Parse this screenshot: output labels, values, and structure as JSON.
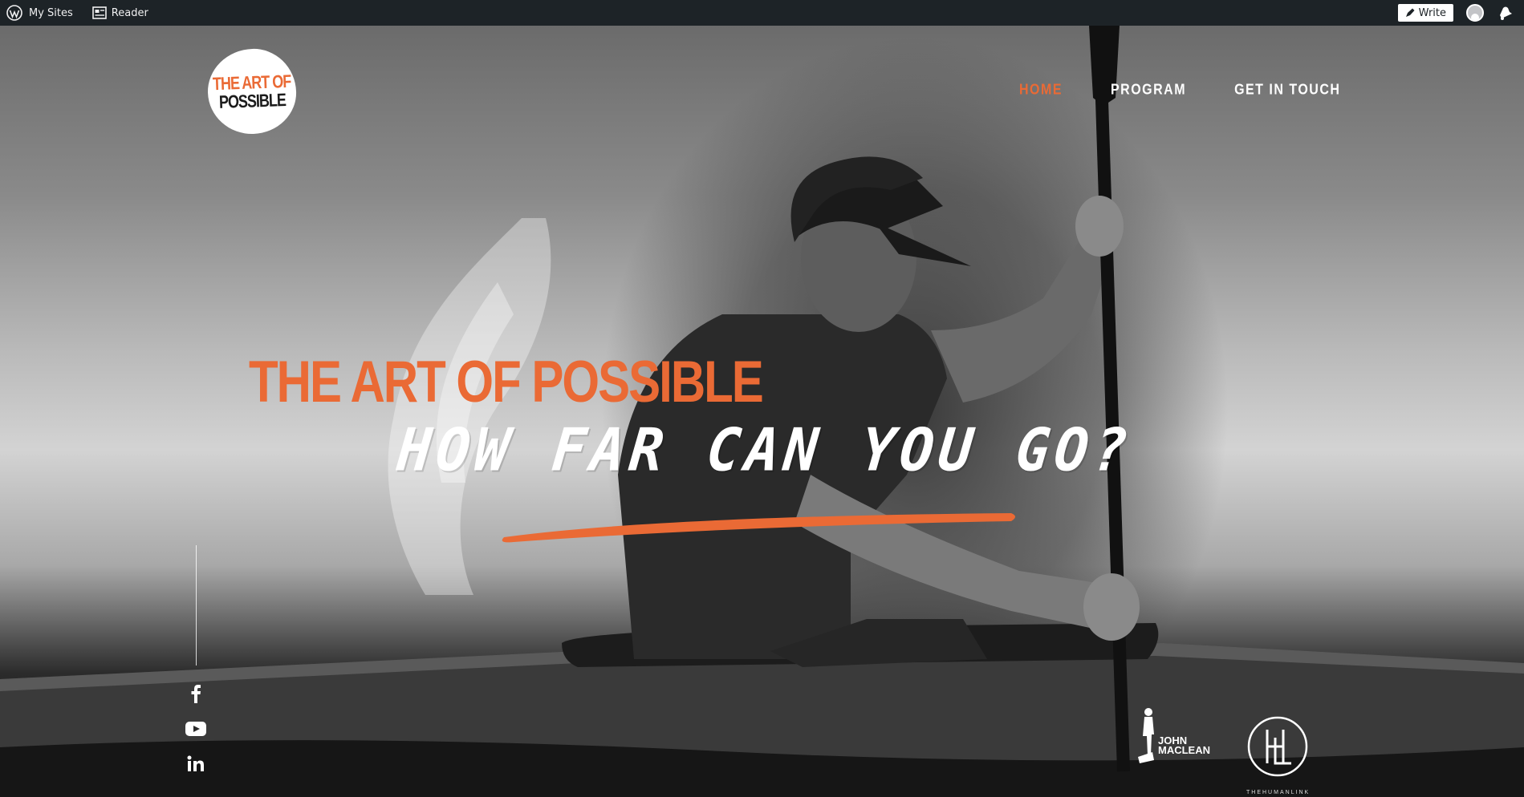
{
  "adminbar": {
    "my_sites": "My Sites",
    "reader": "Reader",
    "write": "Write"
  },
  "logo": {
    "line1": "THE ART OF",
    "line2": "POSSIBLE"
  },
  "nav": {
    "items": [
      {
        "label": "HOME",
        "active": true
      },
      {
        "label": "PROGRAM",
        "active": false
      },
      {
        "label": "GET IN TOUCH",
        "active": false
      }
    ]
  },
  "hero": {
    "title": "THE ART OF POSSIBLE",
    "tagline": "HOW FAR CAN YOU GO?"
  },
  "social": [
    "facebook-icon",
    "youtube-icon",
    "linkedin-icon"
  ],
  "partners": {
    "john_maclean": [
      "JOHN",
      "MACLEAN"
    ],
    "human_link": "THEHUMANLINK"
  },
  "colors": {
    "accent": "#ea6a35",
    "adminbar": "#1d2327"
  }
}
